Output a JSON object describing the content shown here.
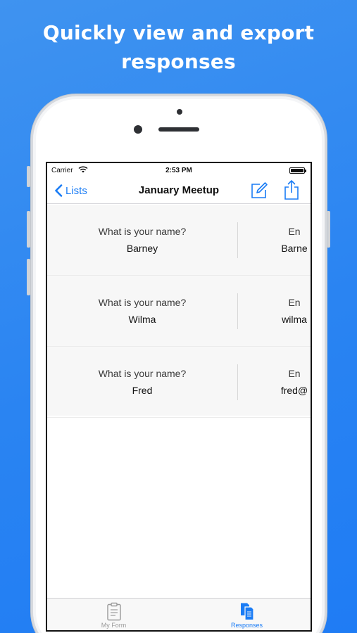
{
  "headline": {
    "line1": "Quickly view and export",
    "line2": "responses"
  },
  "status_bar": {
    "carrier": "Carrier",
    "time": "2:53 PM",
    "battery_level": 1.0
  },
  "nav_bar": {
    "back_label": "Lists",
    "title": "January Meetup",
    "icons": [
      "chevron-left-icon",
      "compose-icon",
      "share-icon"
    ]
  },
  "responses": [
    {
      "q1_label": "What is your name?",
      "q1_value": "Barney",
      "q2_label": "En",
      "q2_value": "Barne"
    },
    {
      "q1_label": "What is your name?",
      "q1_value": "Wilma",
      "q2_label": "En",
      "q2_value": "wilma"
    },
    {
      "q1_label": "What is your name?",
      "q1_value": "Fred",
      "q2_label": "En",
      "q2_value": "fred@"
    }
  ],
  "tab_bar": {
    "tabs": [
      {
        "label": "My Form",
        "icon": "clipboard-icon",
        "selected": false
      },
      {
        "label": "Responses",
        "icon": "documents-icon",
        "selected": true
      }
    ]
  },
  "colors": {
    "background": "#2a84f2",
    "accent": "#1a7cf5",
    "inactive_tab": "#9a9a9a"
  }
}
